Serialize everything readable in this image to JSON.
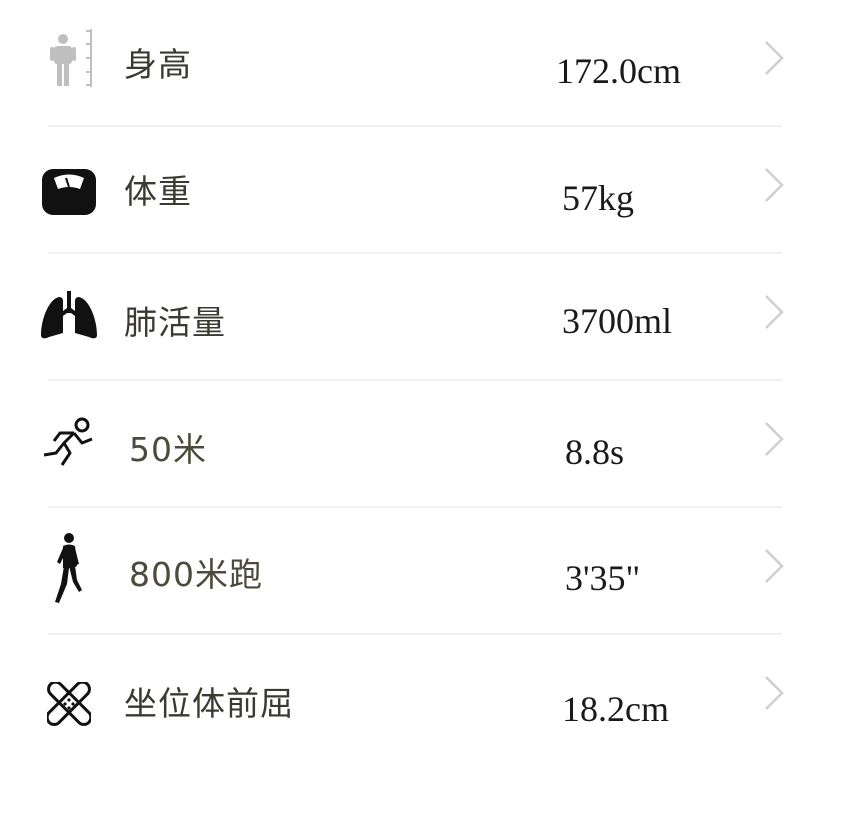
{
  "items": [
    {
      "label": "身高",
      "value": "172.0cm",
      "icon": "height-ruler-person-icon"
    },
    {
      "label": "体重",
      "value": "57kg",
      "icon": "weighing-scale-icon"
    },
    {
      "label": "肺活量",
      "value": "3700ml",
      "icon": "lungs-icon"
    },
    {
      "label": "50米",
      "value": "8.8s",
      "icon": "sprinter-icon"
    },
    {
      "label": "800米跑",
      "value": "3'35\"",
      "icon": "runner-silhouette-icon"
    },
    {
      "label": "坐位体前屈",
      "value": "18.2cm",
      "icon": "stretch-icon"
    }
  ],
  "colors": {
    "label": "#3b3a32",
    "value": "#1a1a1a",
    "chevron": "#cfcfcf",
    "divider": "#f0f0f0",
    "height_icon": "#bfbfbf"
  }
}
